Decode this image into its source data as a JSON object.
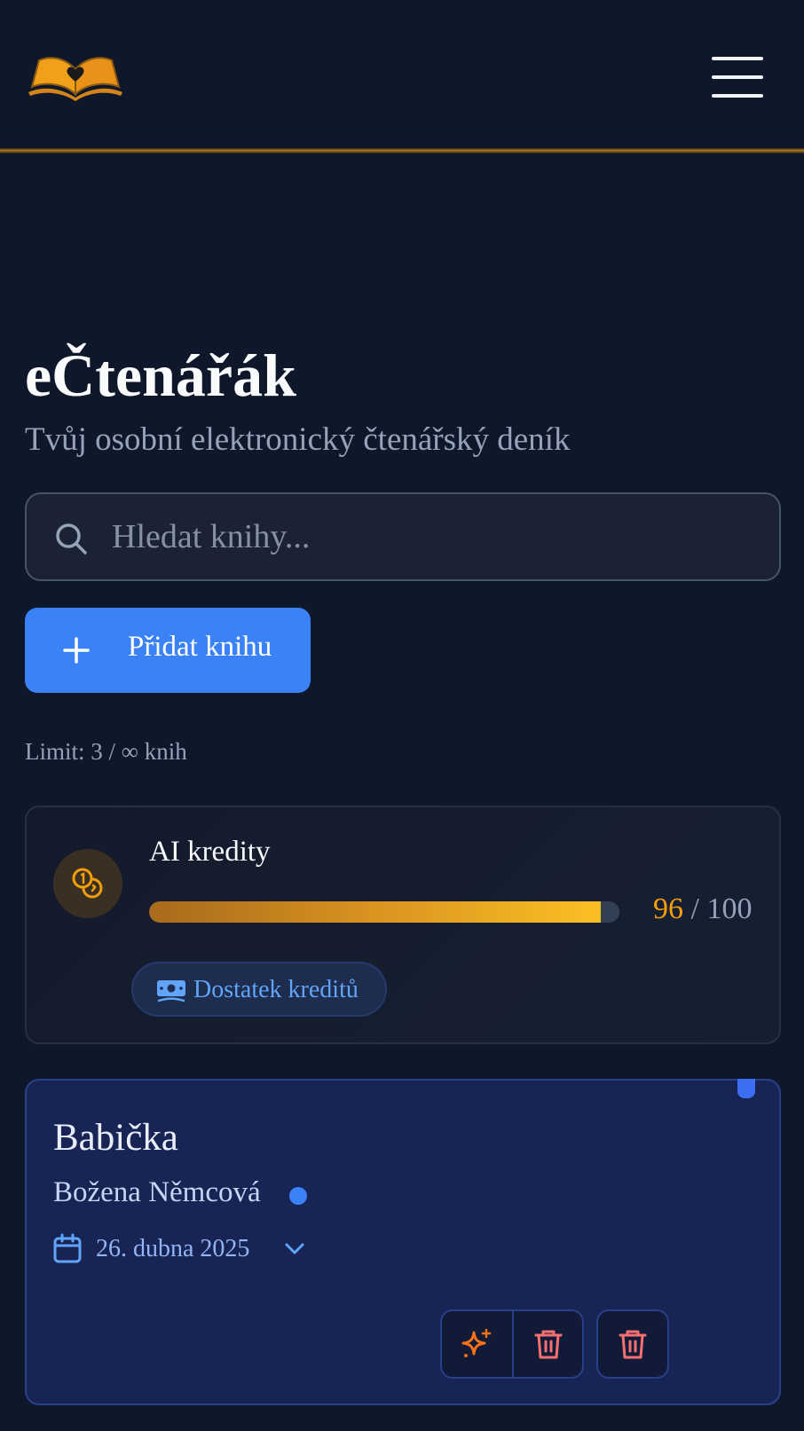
{
  "header": {
    "logo_icon": "open-book-heart-icon",
    "menu_icon": "hamburger-menu-icon"
  },
  "app": {
    "title": "eČtenářák",
    "subtitle": "Tvůj osobní elektronický čtenářský deník"
  },
  "search": {
    "icon": "search-icon",
    "placeholder": "Hledat knihy...",
    "value": ""
  },
  "actions": {
    "add_book_label": "Přidat knihu",
    "add_icon": "plus-icon"
  },
  "limit": {
    "text": "Limit: 3 / ∞ knih"
  },
  "credits": {
    "label": "AI kredity",
    "used": "96",
    "separator": " / ",
    "total": "100",
    "fill_fraction": 0.96,
    "badge_label": "Dostatek kreditů",
    "badge_icon": "banknote-icon",
    "coin_icon": "coins-icon"
  },
  "books": [
    {
      "title": "Babička",
      "author": "Božena Němcová",
      "date": "26. dubna 2025",
      "status_color": "#3b82f6",
      "calendar_icon": "calendar-icon",
      "expand_icon": "chevron-down-icon",
      "action_icons": [
        "sparkles-icon",
        "trash-icon",
        "trash-icon"
      ]
    }
  ],
  "colors": {
    "background": "#0f172a",
    "accent_blue": "#3b82f6",
    "accent_gold": "#f59e0b",
    "danger": "#f87171"
  }
}
